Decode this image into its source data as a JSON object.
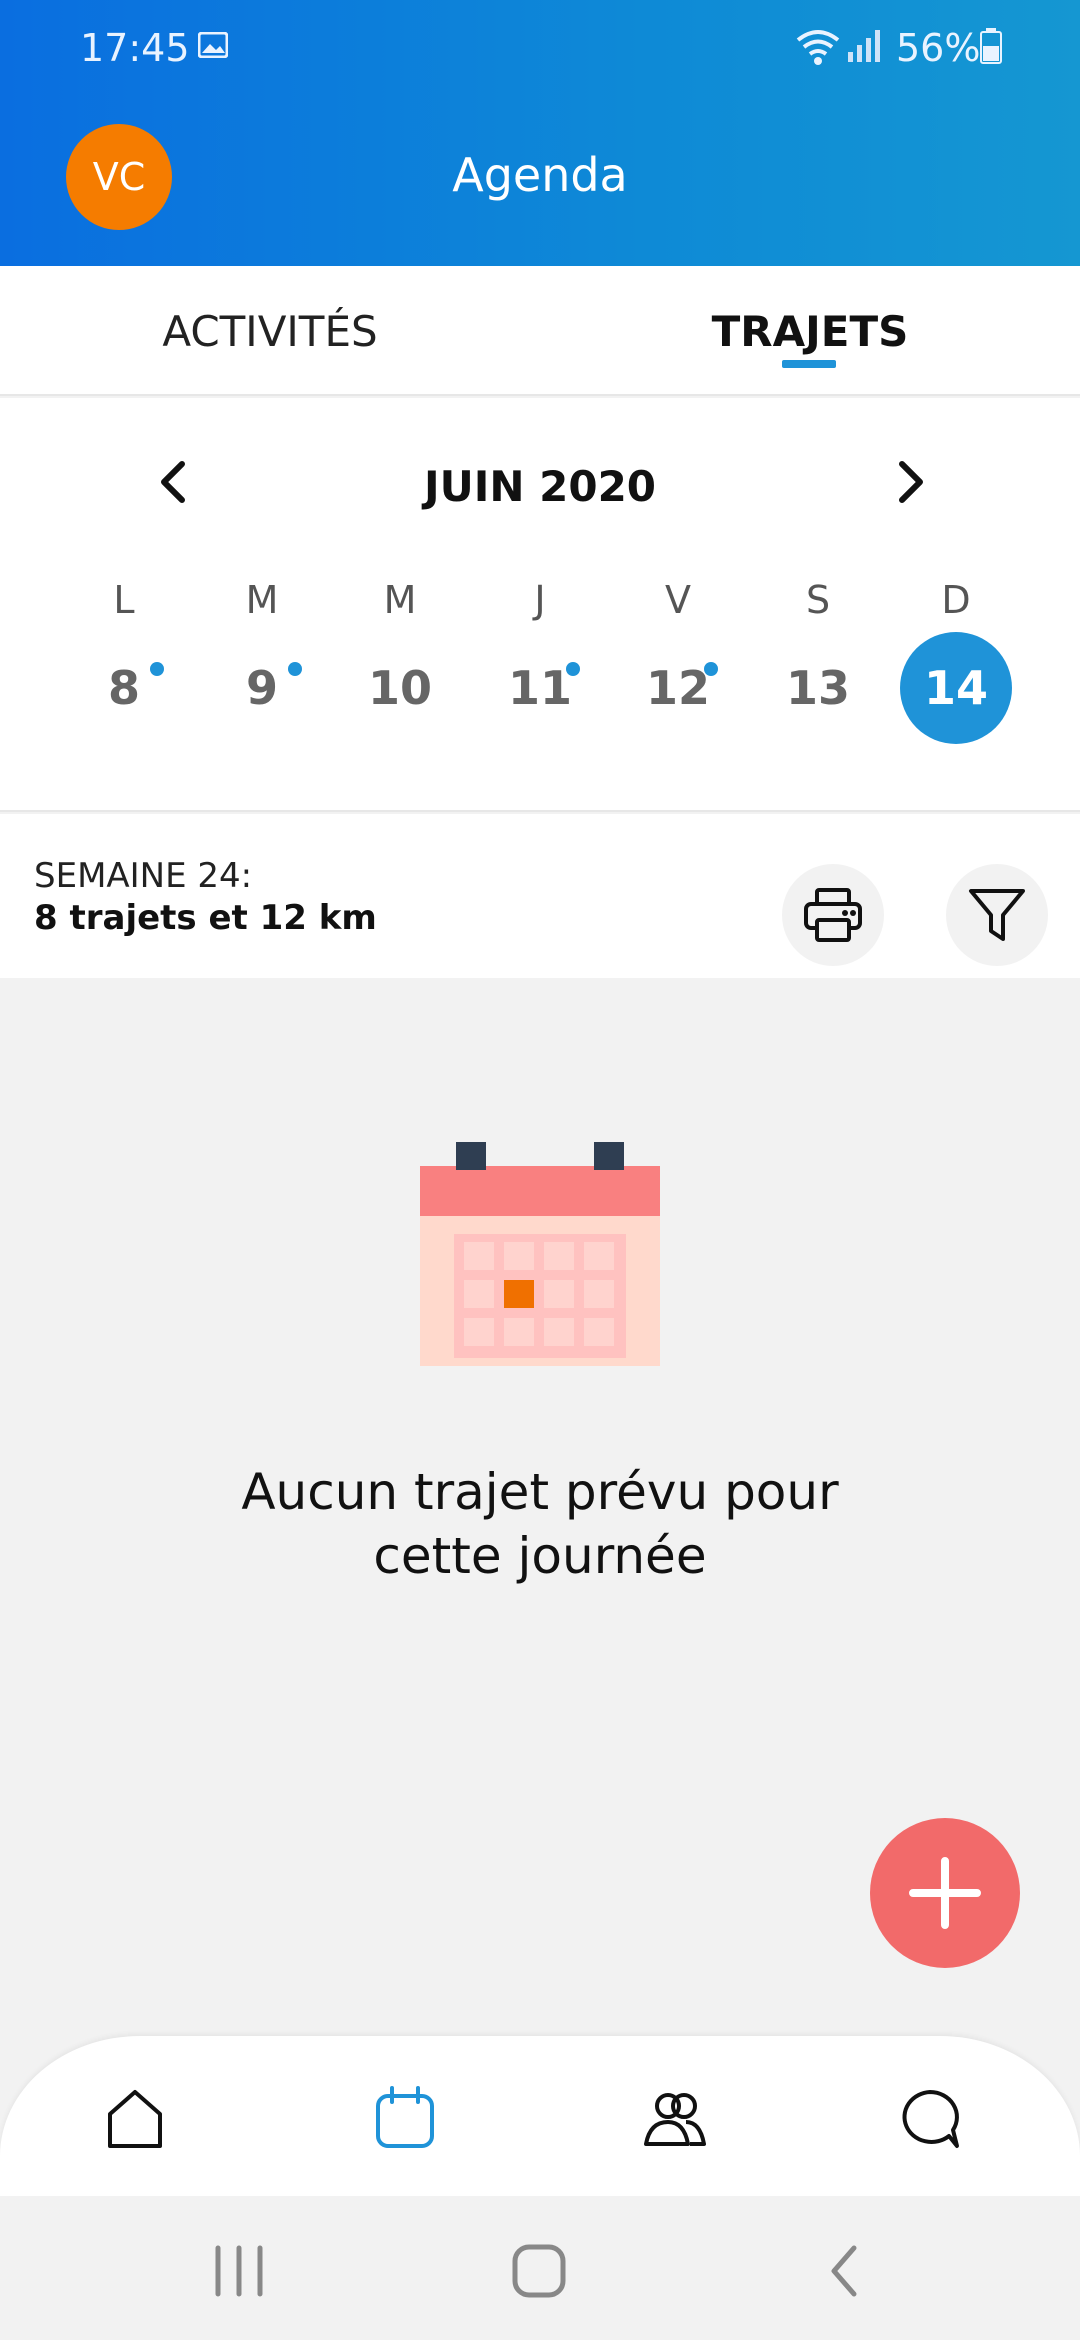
{
  "status": {
    "time": "17:45",
    "battery": "56%"
  },
  "header": {
    "avatar_initials": "VC",
    "title": "Agenda"
  },
  "tabs": [
    {
      "label": "ACTIVITÉS"
    },
    {
      "label": "TRAJETS",
      "active": true
    }
  ],
  "calendar": {
    "month": "JUIN 2020",
    "days": [
      {
        "letter": "L",
        "num": "8",
        "dot": true
      },
      {
        "letter": "M",
        "num": "9",
        "dot": true
      },
      {
        "letter": "M",
        "num": "10",
        "dot": false
      },
      {
        "letter": "J",
        "num": "11",
        "dot": true
      },
      {
        "letter": "V",
        "num": "12",
        "dot": true
      },
      {
        "letter": "S",
        "num": "13",
        "dot": false
      },
      {
        "letter": "D",
        "num": "14",
        "dot": false,
        "selected": true
      }
    ]
  },
  "summary": {
    "week_label": "SEMAINE 24:",
    "stats": "8 trajets et 12 km"
  },
  "empty_state": {
    "line1": "Aucun trajet prévu pour",
    "line2": "cette journée"
  },
  "colors": {
    "accent": "#1f93d8",
    "avatar": "#f57c00",
    "fab": "#f26a6a"
  },
  "bottom_nav": [
    {
      "icon": "home-icon"
    },
    {
      "icon": "calendar-icon",
      "active": true
    },
    {
      "icon": "users-icon"
    },
    {
      "icon": "chat-icon"
    }
  ]
}
